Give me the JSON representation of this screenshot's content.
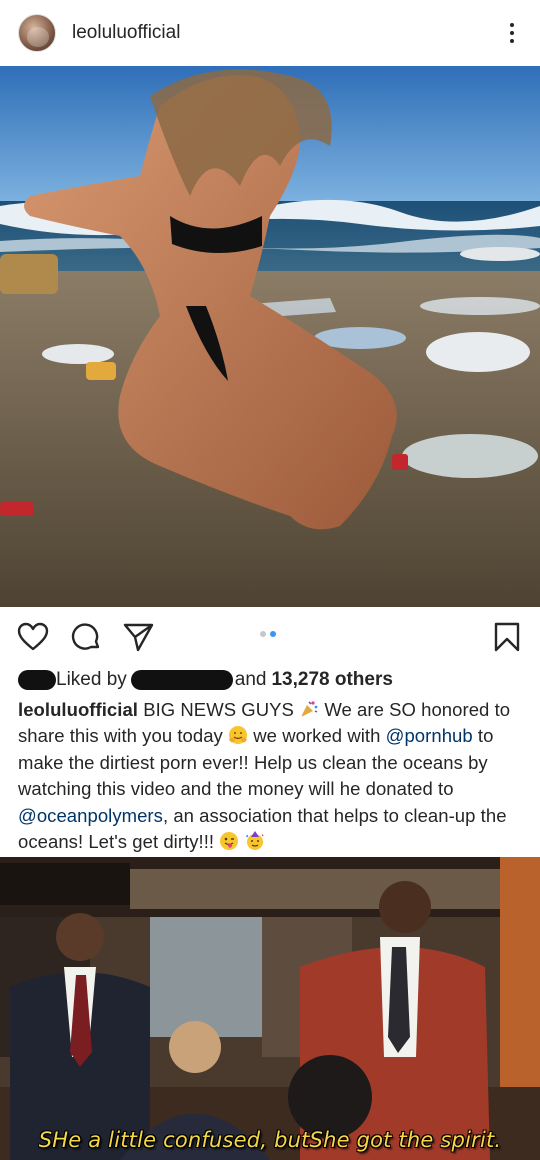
{
  "post": {
    "username": "leoluluofficial",
    "more_icon": "more-vertical-icon"
  },
  "actions": {
    "like_icon": "heart-icon",
    "comment_icon": "comment-icon",
    "share_icon": "paper-plane-icon",
    "save_icon": "bookmark-icon",
    "carousel": {
      "count": 2,
      "active_index": 1
    }
  },
  "likes": {
    "prefix": "Liked by",
    "and": "and",
    "others": "13,278 others"
  },
  "caption": {
    "username": "leoluluofficial",
    "part1": "BIG NEWS GUYS",
    "part2": "We are SO honored to share this with you today",
    "part3": "we worked with",
    "mention1": "@pornhub",
    "part4": "to make the dirtiest porn ever!! Help us clean the oceans by watching this video and the money will he donated to",
    "mention2": "@oceanpolymers",
    "part5": ", an association that helps to clean-up the oceans! Let's get dirty!!!",
    "emojis": [
      "party-popper",
      "hugging-face",
      "winking-tongue-face",
      "party-face"
    ]
  },
  "meme": {
    "caption": "SHe a little confused, butShe got the spirit."
  },
  "colors": {
    "mention": "#003569",
    "carousel_active": "#3897f0",
    "meme_caption": "#f4d74a"
  }
}
